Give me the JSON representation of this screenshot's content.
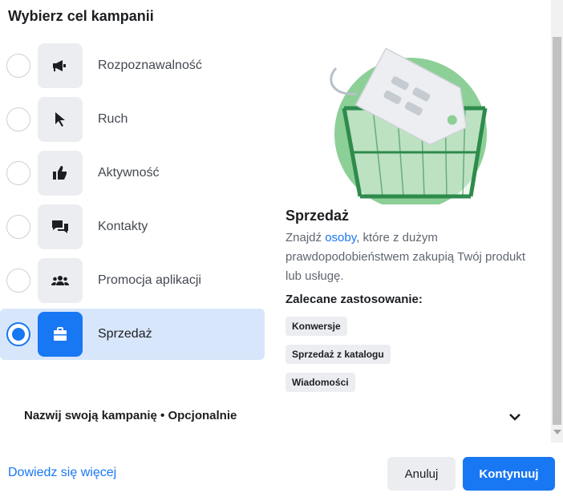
{
  "dialog": {
    "title": "Wybierz cel kampanii"
  },
  "objectives": [
    {
      "label": "Rozpoznawalność",
      "icon": "megaphone-icon",
      "selected": false
    },
    {
      "label": "Ruch",
      "icon": "cursor-icon",
      "selected": false
    },
    {
      "label": "Aktywność",
      "icon": "thumbs-up-icon",
      "selected": false
    },
    {
      "label": "Kontakty",
      "icon": "chat-bubbles-icon",
      "selected": false
    },
    {
      "label": "Promocja aplikacji",
      "icon": "people-icon",
      "selected": false
    },
    {
      "label": "Sprzedaż",
      "icon": "shopping-bag-icon",
      "selected": true
    }
  ],
  "detail": {
    "title": "Sprzedaż",
    "desc_before": "Znajdź ",
    "desc_link": "osoby",
    "desc_after": ", które z dużym prawdopodobieństwem zakupią Twój produkt lub usługę.",
    "recommended_title": "Zalecane zastosowanie:",
    "tags": [
      "Konwersje",
      "Sprzedaż z katalogu",
      "Wiadomości"
    ]
  },
  "campaign_name": {
    "label": "Nazwij swoją kampanię • Opcjonalnie"
  },
  "footer": {
    "learn_more": "Dowiedz się więcej",
    "cancel": "Anuluj",
    "continue": "Kontynuuj"
  },
  "colors": {
    "accent": "#1877f2",
    "selected_bg": "#d7e6fb",
    "illustration_green": "#8ccf97"
  }
}
